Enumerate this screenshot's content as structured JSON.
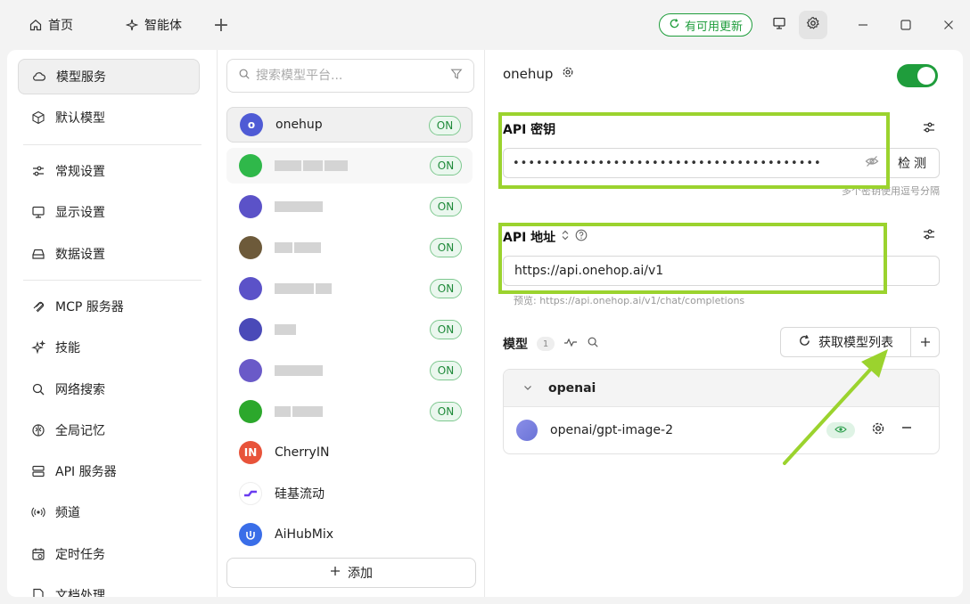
{
  "topbar": {
    "tabs": [
      {
        "label": "首页",
        "icon": "home-icon"
      },
      {
        "label": "智能体",
        "icon": "sparkle-icon"
      }
    ],
    "update_label": "有可用更新"
  },
  "nav": {
    "items": [
      {
        "label": "模型服务",
        "icon": "cloud-icon",
        "active": true
      },
      {
        "label": "默认模型",
        "icon": "cube-icon"
      },
      {
        "label": "常规设置",
        "icon": "sliders-icon"
      },
      {
        "label": "显示设置",
        "icon": "monitor-icon"
      },
      {
        "label": "数据设置",
        "icon": "drive-icon"
      },
      {
        "label": "MCP 服务器",
        "icon": "link-icon"
      },
      {
        "label": "技能",
        "icon": "stars-icon"
      },
      {
        "label": "网络搜索",
        "icon": "search-icon"
      },
      {
        "label": "全局记忆",
        "icon": "brain-icon"
      },
      {
        "label": "API 服务器",
        "icon": "server-icon"
      },
      {
        "label": "频道",
        "icon": "broadcast-icon"
      },
      {
        "label": "定时任务",
        "icon": "calendar-icon"
      },
      {
        "label": "文档处理",
        "icon": "document-icon"
      }
    ]
  },
  "providers": {
    "search_placeholder": "搜索模型平台...",
    "on_label": "ON",
    "items": [
      {
        "name": "onehup",
        "logo_text": "o",
        "logo_color": "#4f5bd5"
      },
      {
        "name": "CherryIN",
        "logo_text": "IN",
        "logo_color": "#e8533a"
      },
      {
        "name": "硅基流动",
        "logo_text": "",
        "logo_color": "#6a3cf0"
      },
      {
        "name": "AiHubMix",
        "logo_text": "",
        "logo_color": "#3a6ee8"
      }
    ],
    "add_label": "添加"
  },
  "settings": {
    "provider_name": "onehup",
    "api_key_label": "API 密钥",
    "api_key_value": "••••••••••••••••••••••••••••••••••••••••",
    "check_label": "检测",
    "key_hint": "多个密钥使用逗号分隔",
    "api_url_label": "API 地址",
    "api_url_value": "https://api.onehop.ai/v1",
    "url_preview": "预览: https://api.onehop.ai/v1/chat/completions",
    "models_label": "模型",
    "models_count": "1",
    "fetch_label": "获取模型列表",
    "group_name": "openai",
    "model_name": "openai/gpt-image-2"
  },
  "colors": {
    "accent": "#1f9d3c",
    "highlight": "#9bd32e"
  }
}
